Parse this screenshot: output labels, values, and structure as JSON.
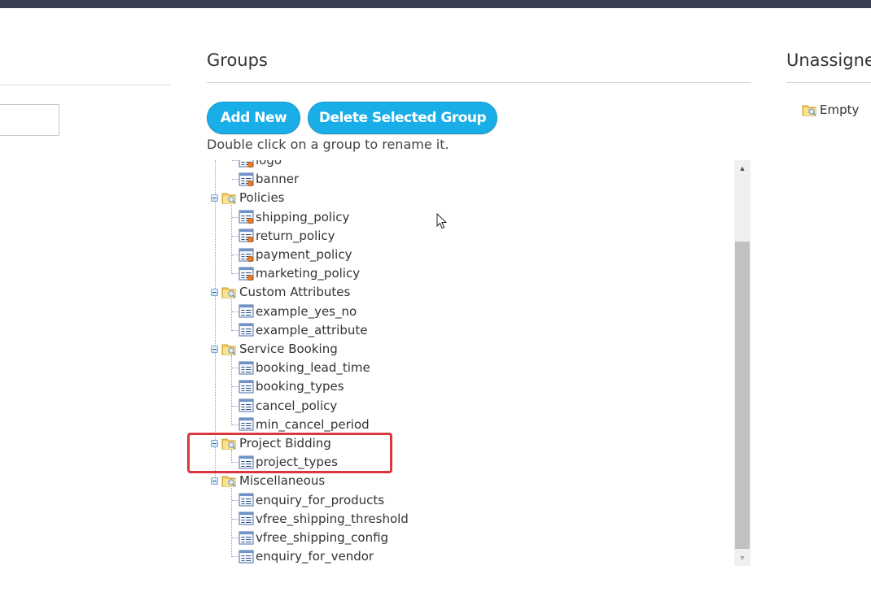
{
  "groups_panel": {
    "title": "Groups",
    "add_button": "Add New",
    "delete_button": "Delete Selected Group",
    "hint": "Double click on a group to rename it.",
    "tree": {
      "policy_items_partial": [
        "logo",
        "banner"
      ],
      "groups": [
        {
          "name": "Policies",
          "items": [
            "shipping_policy",
            "return_policy",
            "payment_policy",
            "marketing_policy"
          ]
        },
        {
          "name": "Custom Attributes",
          "items": [
            "example_yes_no",
            "example_attribute"
          ]
        },
        {
          "name": "Service Booking",
          "items": [
            "booking_lead_time",
            "booking_types",
            "cancel_policy",
            "min_cancel_period"
          ]
        },
        {
          "name": "Project Bidding",
          "items": [
            "project_types"
          ]
        },
        {
          "name": "Miscellaneous",
          "items": [
            "enquiry_for_products",
            "vfree_shipping_threshold",
            "vfree_shipping_config",
            "enquiry_for_vendor"
          ]
        }
      ]
    },
    "highlighted_group": "Project Bidding"
  },
  "unassigned_panel": {
    "title": "Unassigned",
    "items": [
      "Empty"
    ]
  },
  "colors": {
    "button": "#1aaee8",
    "topbar": "#3b3f54",
    "highlight": "#d9363e",
    "scroll_thumb": "#c1c1c1"
  },
  "icons": {
    "group": "folder-icon",
    "attribute": "attribute-icon",
    "policy_attribute": "policy-attribute-icon",
    "expand_collapse": "collapse-icon"
  }
}
